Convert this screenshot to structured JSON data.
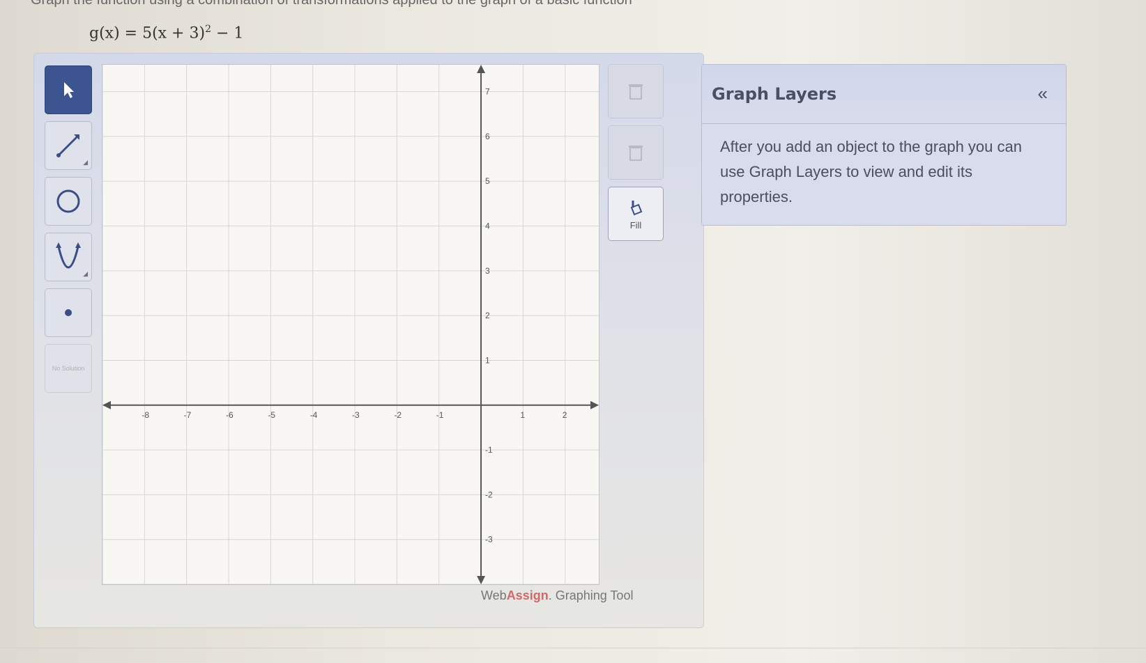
{
  "instruction": "Graph the function using a combination of transformations applied to the graph of a basic function",
  "equation": {
    "lhs": "g(x) = 5(x + 3)",
    "exponent": "2",
    "rhs": " − 1"
  },
  "toolbar": {
    "tools": [
      {
        "name": "pointer-tool",
        "icon": "arrow-pointer-icon"
      },
      {
        "name": "line-tool",
        "icon": "line-icon"
      },
      {
        "name": "circle-tool",
        "icon": "circle-icon"
      },
      {
        "name": "parabola-tool",
        "icon": "parabola-icon"
      },
      {
        "name": "point-tool",
        "icon": "point-icon"
      },
      {
        "name": "no-solution-tool",
        "label": "No Solution"
      }
    ]
  },
  "side_buttons": {
    "delete_icon": "trash-icon",
    "fill_label": "Fill",
    "fill_icon": "paint-bucket-icon"
  },
  "graph": {
    "x_ticks": [
      "-8",
      "-7",
      "-6",
      "-5",
      "-4",
      "-3",
      "-2",
      "-1",
      "1",
      "2"
    ],
    "y_ticks": [
      "7",
      "6",
      "5",
      "4",
      "3",
      "2",
      "1",
      "-1",
      "-2",
      "-3"
    ]
  },
  "credit": {
    "brand_prefix": "Web",
    "brand": "Assign",
    "suffix": ". Graphing Tool"
  },
  "layers": {
    "title": "Graph Layers",
    "collapse_icon": "«",
    "body": "After you add an object to the graph you can use Graph Layers to view and edit its properties."
  },
  "colors": {
    "active_tool": "#3c5590",
    "panel": "#d4d9ea",
    "brand": "#d06a6a"
  }
}
